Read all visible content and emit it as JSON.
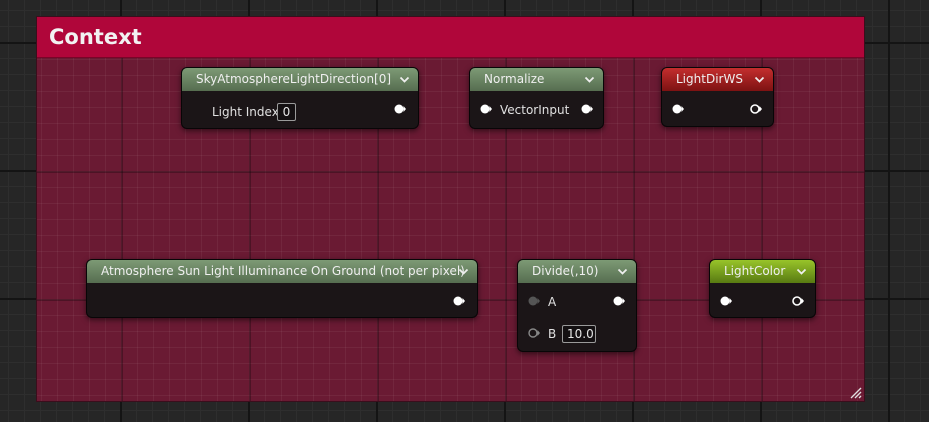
{
  "comment": {
    "title": "Context",
    "color": "#b0063a"
  },
  "nodes": {
    "sky_light_dir": {
      "title": "SkyAtmosphereLightDirection[0]",
      "input_label": "Light Index",
      "input_value": "0"
    },
    "normalize": {
      "title": "Normalize",
      "input_label": "VectorInput"
    },
    "light_dir_ws": {
      "title": "LightDirWS"
    },
    "sun_illuminance": {
      "title": "Atmosphere Sun Light Illuminance On Ground (not per pixel)"
    },
    "divide": {
      "title": "Divide(,10)",
      "input_a_label": "A",
      "input_b_label": "B",
      "input_b_value": "10.0"
    },
    "light_color": {
      "title": "LightColor"
    }
  },
  "icons": [
    "chevron-down-icon",
    "output-pin-icon",
    "input-pin-icon",
    "resize-grip-icon"
  ]
}
